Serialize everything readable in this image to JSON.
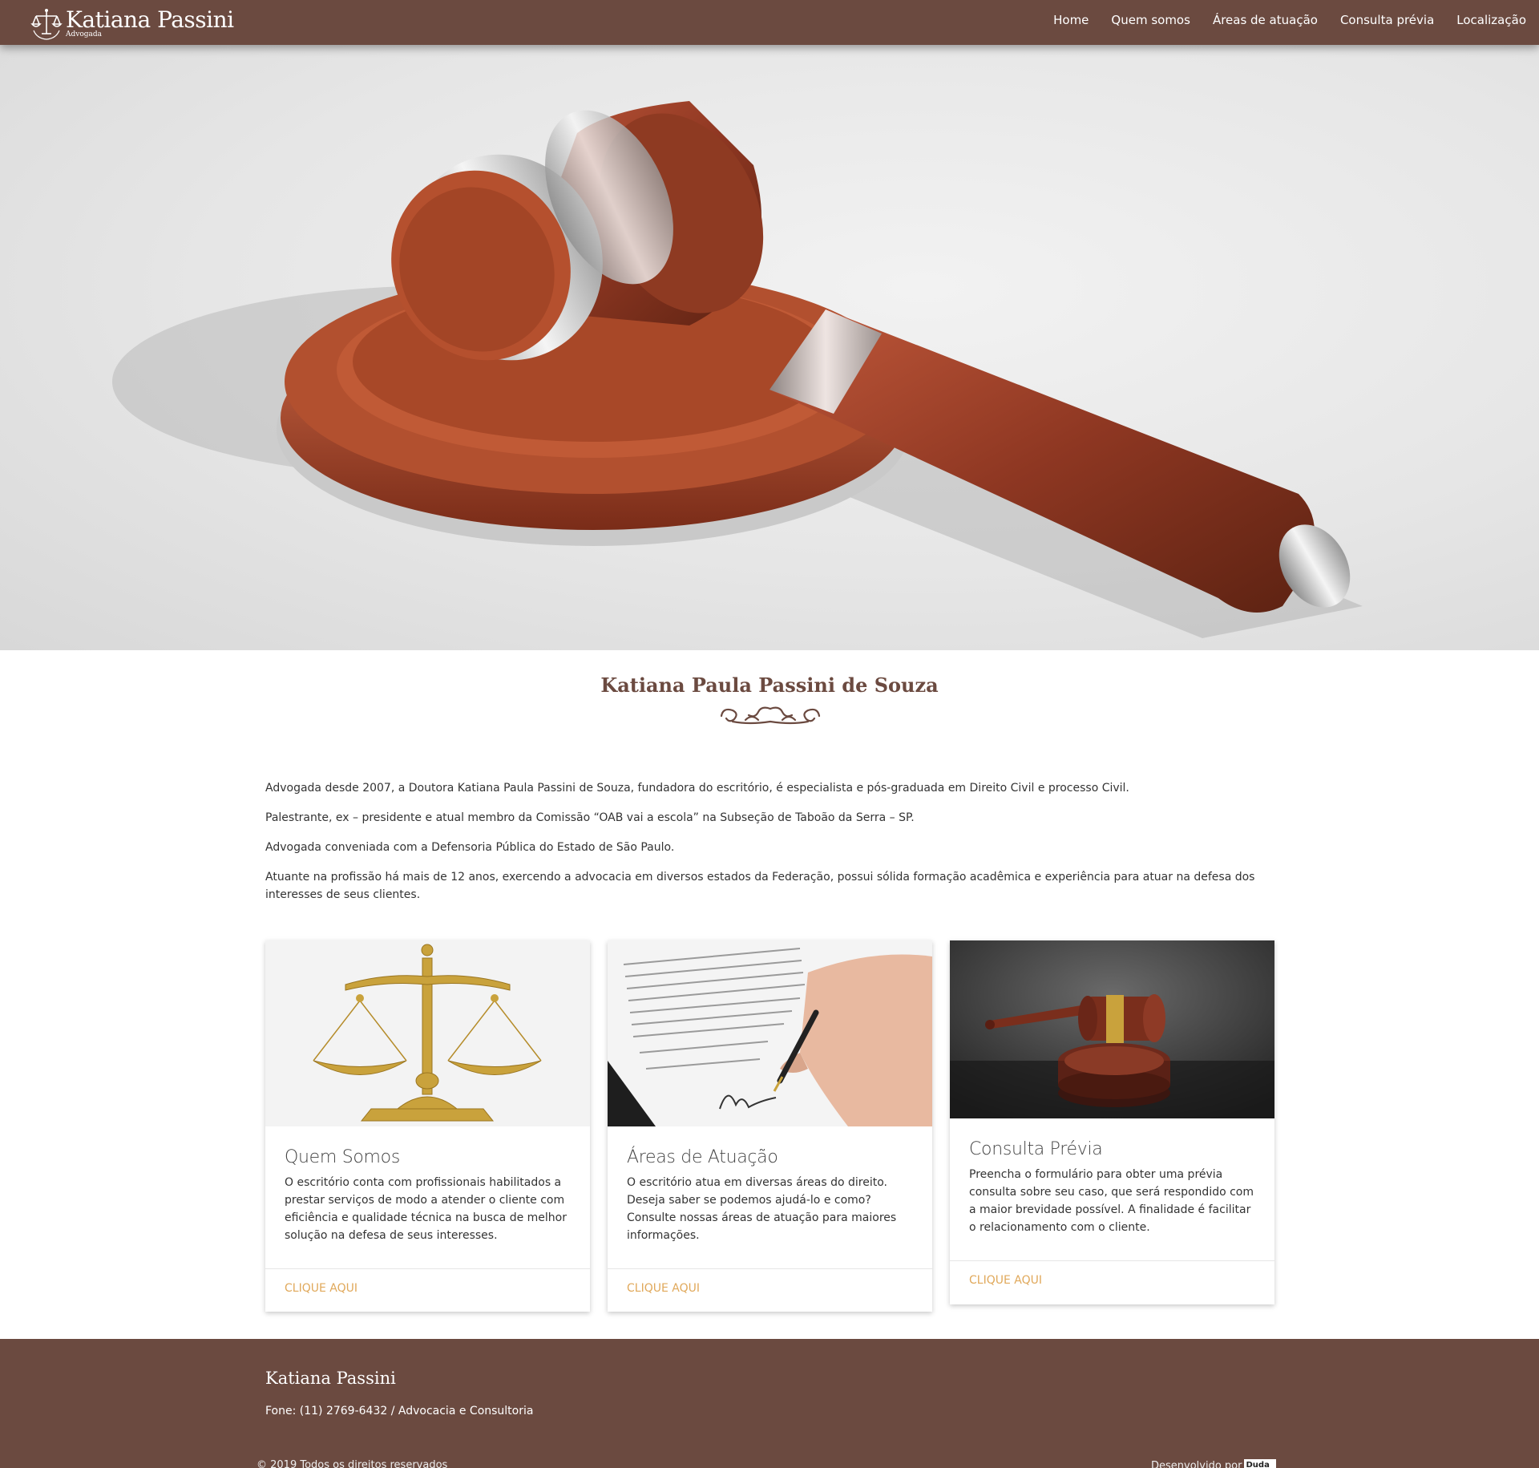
{
  "brand": {
    "name": "Katiana Passini",
    "subtitle": "Advogada"
  },
  "nav": {
    "items": [
      "Home",
      "Quem somos",
      "Áreas de atuação",
      "Consulta prévia",
      "Localização"
    ]
  },
  "profile": {
    "title": "Katiana Paula Passini de Souza"
  },
  "bio": {
    "paragraphs": [
      "Advogada desde 2007, a Doutora Katiana Paula Passini de Souza, fundadora do escritório, é especialista e pós-graduada em Direito Civil e processo Civil.",
      "Palestrante, ex – presidente e atual membro da Comissão “OAB vai a escola” na Subseção de Taboão da Serra – SP.",
      "Advogada conveniada com a Defensoria Pública do Estado de São Paulo.",
      "Atuante na profissão há mais de 12 anos, exercendo a advocacia em diversos estados da Federação, possui sólida formação acadêmica e experiência para atuar na defesa dos interesses de seus clientes."
    ]
  },
  "cards": [
    {
      "title": "Quem Somos",
      "text": "O escritório conta com profissionais habilitados a prestar serviços de modo a atender o cliente com eficiência e qualidade técnica na busca de melhor solução na defesa de seus interesses.",
      "link": "CLIQUE AQUI"
    },
    {
      "title": "Áreas de Atuação",
      "text": "O escritório atua em diversas áreas do direito. Deseja saber se podemos ajudá-lo e como? Consulte nossas áreas de atuação para maiores informações.",
      "link": "CLIQUE AQUI"
    },
    {
      "title": "Consulta Prévia",
      "text": "Preencha o formulário para obter uma prévia consulta sobre seu caso, que será respondido com a maior brevidade possível. A finalidade é facilitar o relacionamento com o cliente.",
      "link": "CLIQUE AQUI"
    }
  ],
  "footer": {
    "name": "Katiana Passini",
    "phone": "Fone: (11) 2769-6432 / Advocacia e Consultoria",
    "copyright": "© 2019 Todos os direitos reservados",
    "developed_by": "Desenvolvido por",
    "developer_badge": "Duda"
  },
  "colors": {
    "primary": "#6b4a40",
    "link": "#e0a85a",
    "background": "#ffffff"
  },
  "icons": {
    "logo": "scales-of-justice-icon",
    "ornament": "scroll-ornament-icon"
  }
}
